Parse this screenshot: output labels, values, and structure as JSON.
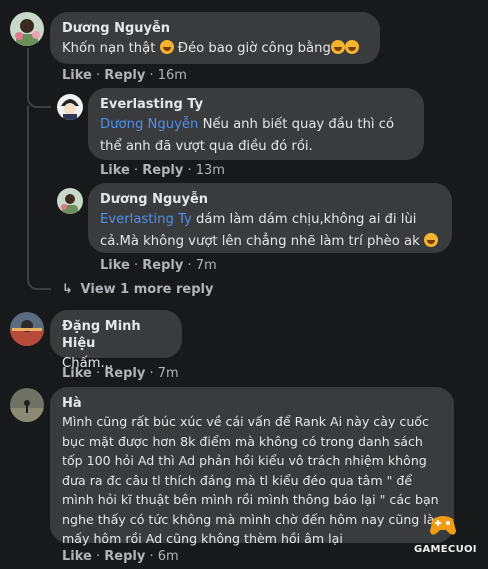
{
  "comments": [
    {
      "author": "Dương Nguyễn",
      "text": "Khốn nạn thật",
      "text_after": " Đéo bao giờ công bằng",
      "like": "Like",
      "reply": "Reply",
      "time": "16m",
      "replies": [
        {
          "author": "Everlasting Ty",
          "mention": "Dương Nguyễn",
          "text": " Nếu anh biết quay đầu thì có thể anh đã vượt qua điều đó rồi.",
          "like": "Like",
          "reply": "Reply",
          "time": "13m"
        },
        {
          "author": "Dương Nguyễn",
          "mention": "Everlasting Ty",
          "text": " dám làm dám chịu,không ai đi lùi cả.Mà không vượt lên chẳng nhẽ làm trí phèo ak",
          "like": "Like",
          "reply": "Reply",
          "time": "7m"
        }
      ],
      "view_more": "View 1 more reply"
    },
    {
      "author": "Đặng Minh Hiệu",
      "text": "Chấm...",
      "like": "Like",
      "reply": "Reply",
      "time": "7m"
    },
    {
      "author": "Hà",
      "text": "Mình cũng rất búc xúc về cái vấn để Rank Ai này cày cuốc bục mặt được hơn 8k điểm mà không có trong danh sách tốp 100 hỏi Ad thì Ad phản hồi kiểu vô trách nhiệm không đưa ra đc câu tl thích đáng mà tl kiểu đéo qua tâm \" để mình hỏi kĩ thuật bên mình rồi mình thông báo lại \" các bạn nghe thấy có tức không mà mình chờ đến hôm nay cũng là mấy hôm rồi Ad cũng không thèm hồi âm lại",
      "like": "Like",
      "reply": "Reply",
      "time": "6m"
    }
  ],
  "watermark": "GAMECUOI",
  "colors": {
    "background": "#18191a",
    "bubble": "#3a3b3c",
    "mention": "#4e8ff0",
    "muted": "#b0b3b8"
  }
}
